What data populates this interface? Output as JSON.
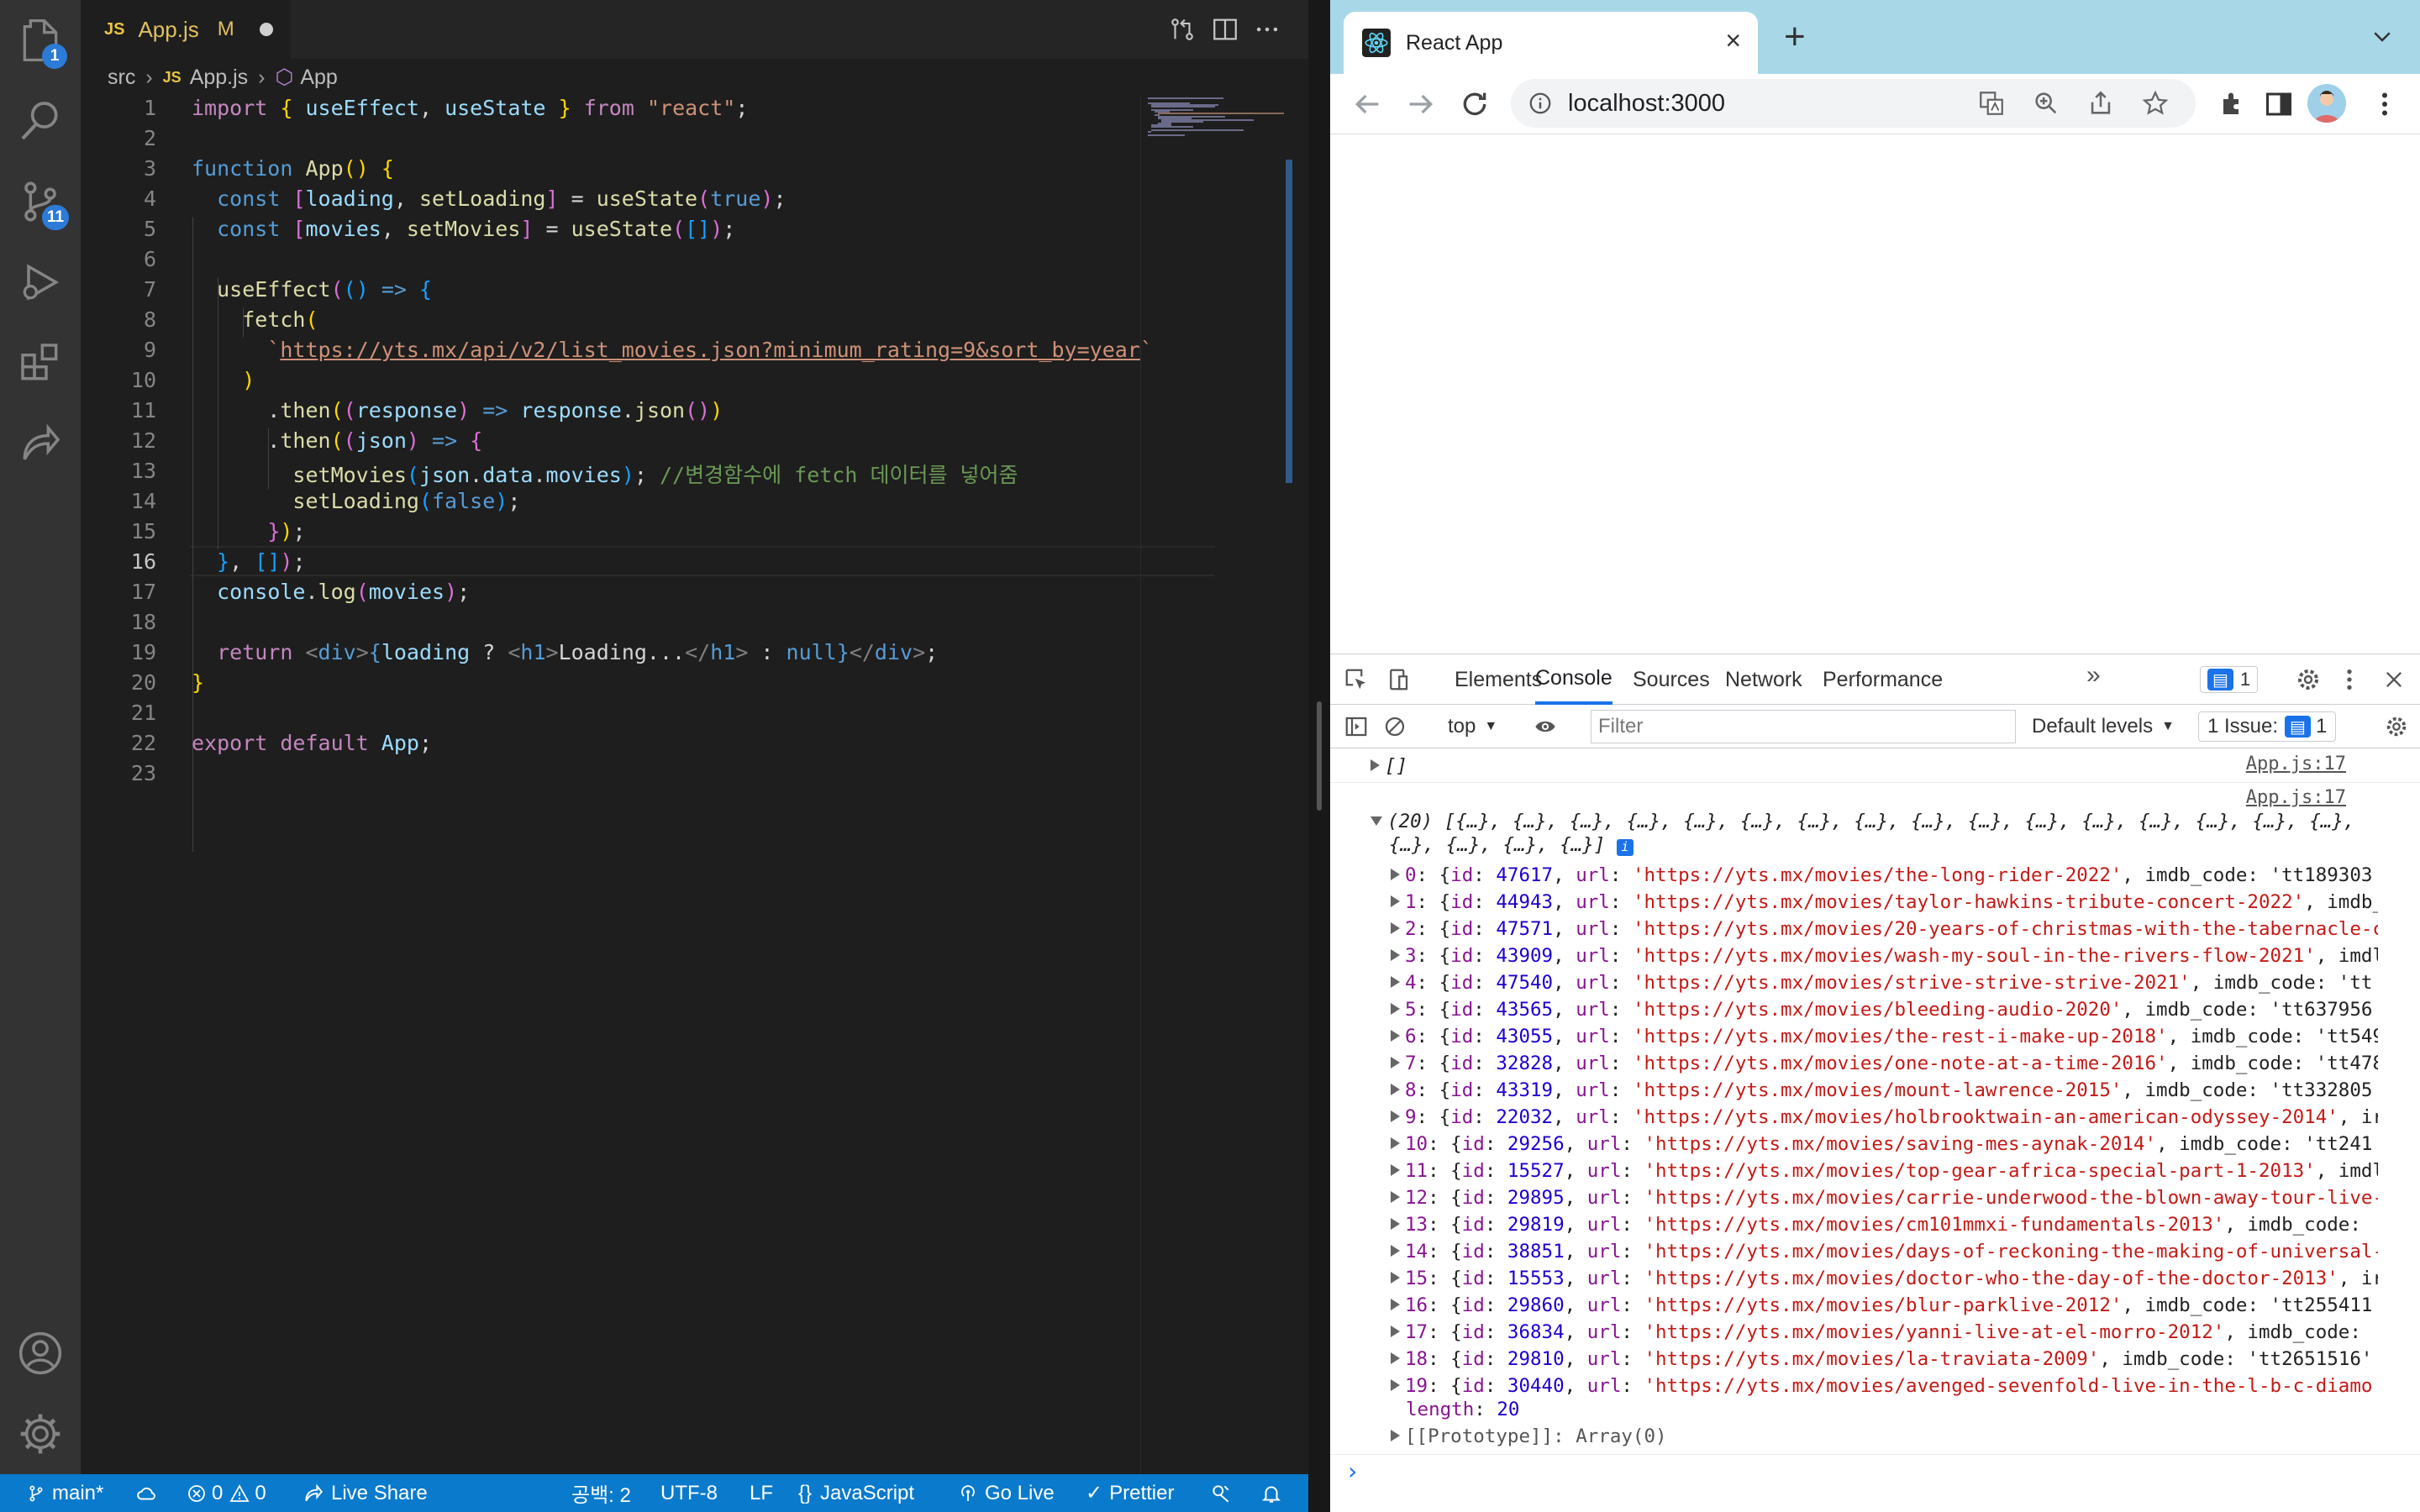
{
  "vscode": {
    "activity": {
      "explorer_badge": "1",
      "scm_badge": "11"
    },
    "tab": {
      "lang": "JS",
      "filename": "App.js",
      "status": "M"
    },
    "breadcrumb": {
      "folder": "src",
      "file_lang": "JS",
      "file": "App.js",
      "symbol": "App"
    },
    "comment_text": "//변경함수에 fetch 데이터를 넣어줌",
    "url_text": "https://yts.mx/api/v2/list_movies.json?minimum_rating=9&sort_by=year",
    "line_numbers": [
      "1",
      "2",
      "3",
      "4",
      "5",
      "6",
      "7",
      "8",
      "9",
      "10",
      "11",
      "12",
      "13",
      "14",
      "15",
      "16",
      "17",
      "18",
      "19",
      "20",
      "21",
      "22",
      "23"
    ],
    "current_line": "16",
    "statusbar": {
      "branch": "main*",
      "errors": "0",
      "warnings": "0",
      "live_share": "Live Share",
      "spaces": "공백: 2",
      "encoding": "UTF-8",
      "eol": "LF",
      "language": "JavaScript",
      "go_live": "Go Live",
      "prettier": "Prettier"
    }
  },
  "chrome": {
    "tab_title": "React App",
    "address": "localhost:3000",
    "devtools": {
      "tabs": [
        "Elements",
        "Console",
        "Sources",
        "Network",
        "Performance"
      ],
      "active_tab": "Console",
      "message_badge": "1",
      "context": "top",
      "filter_placeholder": "Filter",
      "levels": "Default levels",
      "issues_label": "1 Issue:",
      "issues_count": "1",
      "first_log": "[]",
      "source": "App.js:17",
      "array_header_a": "(20) [{…}, {…}, {…}, {…}, {…}, {…}, {…}, {…}, {…}, {…}, {…}, {…}, {…}, {…}, {…}, {…},",
      "array_header_b": "{…}, {…}, {…}, {…}]",
      "movies": [
        {
          "i": "0",
          "id": "47617",
          "url": "'https://yts.mx/movies/the-long-rider-2022'",
          "tail": ", imdb_code: 'tt189303"
        },
        {
          "i": "1",
          "id": "44943",
          "url": "'https://yts.mx/movies/taylor-hawkins-tribute-concert-2022'",
          "tail": ", imdb_"
        },
        {
          "i": "2",
          "id": "47571",
          "url": "'https://yts.mx/movies/20-years-of-christmas-with-the-tabernacle-c",
          "tail": ""
        },
        {
          "i": "3",
          "id": "43909",
          "url": "'https://yts.mx/movies/wash-my-soul-in-the-rivers-flow-2021'",
          "tail": ", imdl"
        },
        {
          "i": "4",
          "id": "47540",
          "url": "'https://yts.mx/movies/strive-strive-strive-2021'",
          "tail": ", imdb_code: 'tt"
        },
        {
          "i": "5",
          "id": "43565",
          "url": "'https://yts.mx/movies/bleeding-audio-2020'",
          "tail": ", imdb_code: 'tt637956"
        },
        {
          "i": "6",
          "id": "43055",
          "url": "'https://yts.mx/movies/the-rest-i-make-up-2018'",
          "tail": ", imdb_code: 'tt549"
        },
        {
          "i": "7",
          "id": "32828",
          "url": "'https://yts.mx/movies/one-note-at-a-time-2016'",
          "tail": ", imdb_code: 'tt478"
        },
        {
          "i": "8",
          "id": "43319",
          "url": "'https://yts.mx/movies/mount-lawrence-2015'",
          "tail": ", imdb_code: 'tt332805"
        },
        {
          "i": "9",
          "id": "22032",
          "url": "'https://yts.mx/movies/holbrooktwain-an-american-odyssey-2014'",
          "tail": ", ir"
        },
        {
          "i": "10",
          "id": "29256",
          "url": "'https://yts.mx/movies/saving-mes-aynak-2014'",
          "tail": ", imdb_code: 'tt241"
        },
        {
          "i": "11",
          "id": "15527",
          "url": "'https://yts.mx/movies/top-gear-africa-special-part-1-2013'",
          "tail": ", imdl"
        },
        {
          "i": "12",
          "id": "29895",
          "url": "'https://yts.mx/movies/carrie-underwood-the-blown-away-tour-live-",
          "tail": ""
        },
        {
          "i": "13",
          "id": "29819",
          "url": "'https://yts.mx/movies/cm101mmxi-fundamentals-2013'",
          "tail": ", imdb_code:"
        },
        {
          "i": "14",
          "id": "38851",
          "url": "'https://yts.mx/movies/days-of-reckoning-the-making-of-universal-",
          "tail": ""
        },
        {
          "i": "15",
          "id": "15553",
          "url": "'https://yts.mx/movies/doctor-who-the-day-of-the-doctor-2013'",
          "tail": ", ir"
        },
        {
          "i": "16",
          "id": "29860",
          "url": "'https://yts.mx/movies/blur-parklive-2012'",
          "tail": ", imdb_code: 'tt255411"
        },
        {
          "i": "17",
          "id": "36834",
          "url": "'https://yts.mx/movies/yanni-live-at-el-morro-2012'",
          "tail": ", imdb_code:"
        },
        {
          "i": "18",
          "id": "29810",
          "url": "'https://yts.mx/movies/la-traviata-2009'",
          "tail": ", imdb_code: 'tt2651516'"
        },
        {
          "i": "19",
          "id": "30440",
          "url": "'https://yts.mx/movies/avenged-sevenfold-live-in-the-l-b-c-diamo",
          "tail": ""
        }
      ],
      "length_key": "length",
      "length_val": "20",
      "prototype": "[[Prototype]]: Array(0)",
      "prompt": "›"
    }
  }
}
